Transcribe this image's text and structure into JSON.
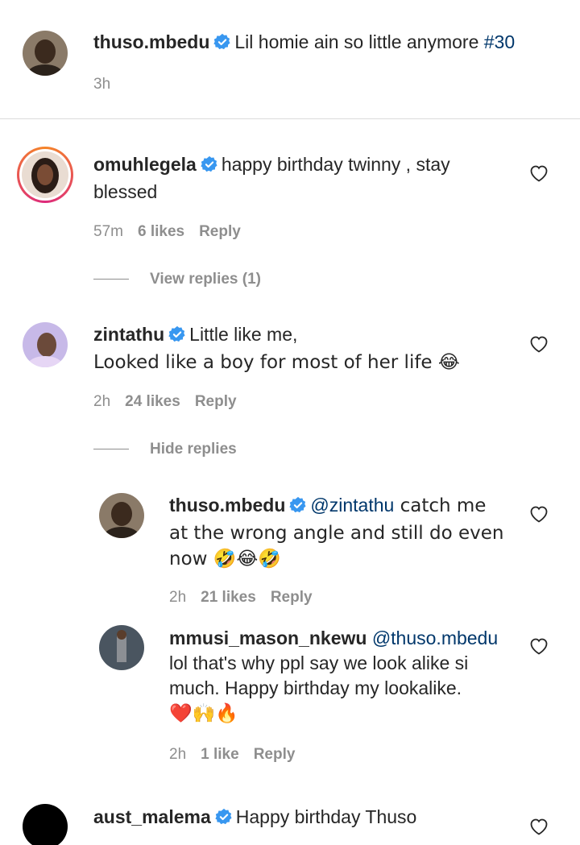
{
  "caption": {
    "username": "thuso.mbedu",
    "text": "Lil homie ain so little anymore ",
    "hashtag": "#30",
    "time": "3h"
  },
  "comments": [
    {
      "username": "omuhlegela",
      "text": "happy birthday twinny , stay blessed",
      "time": "57m",
      "likes": "6 likes",
      "reply": "Reply",
      "view_replies": "View replies (1)"
    },
    {
      "username": "zintathu",
      "text_line1": "Little like me,",
      "text_line2": "Looked like a boy for most of her life 😂",
      "time": "2h",
      "likes": "24 likes",
      "reply": "Reply",
      "hide_replies": "Hide replies",
      "replies": [
        {
          "username": "thuso.mbedu",
          "mention": "@zintathu",
          "text": " catch me at the wrong angle and still do even now 🤣😂🤣",
          "time": "2h",
          "likes": "21 likes",
          "reply": "Reply"
        },
        {
          "username": "mmusi_mason_nkewu",
          "mention": "@thuso.mbedu",
          "text": "lol that's why ppl say we look alike si much. Happy birthday my lookalike.",
          "emoji_line": "❤️🙌🔥",
          "time": "2h",
          "likes": "1 like",
          "reply": "Reply"
        }
      ]
    },
    {
      "username": "aust_malema",
      "text": "Happy birthday Thuso"
    }
  ],
  "colors": {
    "verified": "#3897f0",
    "hashtag": "#00376b",
    "meta": "#8e8e8e",
    "text": "#262626",
    "story_ring": "#dd2a7b"
  },
  "icons": {
    "verified": "verified-badge-icon",
    "like": "heart-outline-icon"
  }
}
